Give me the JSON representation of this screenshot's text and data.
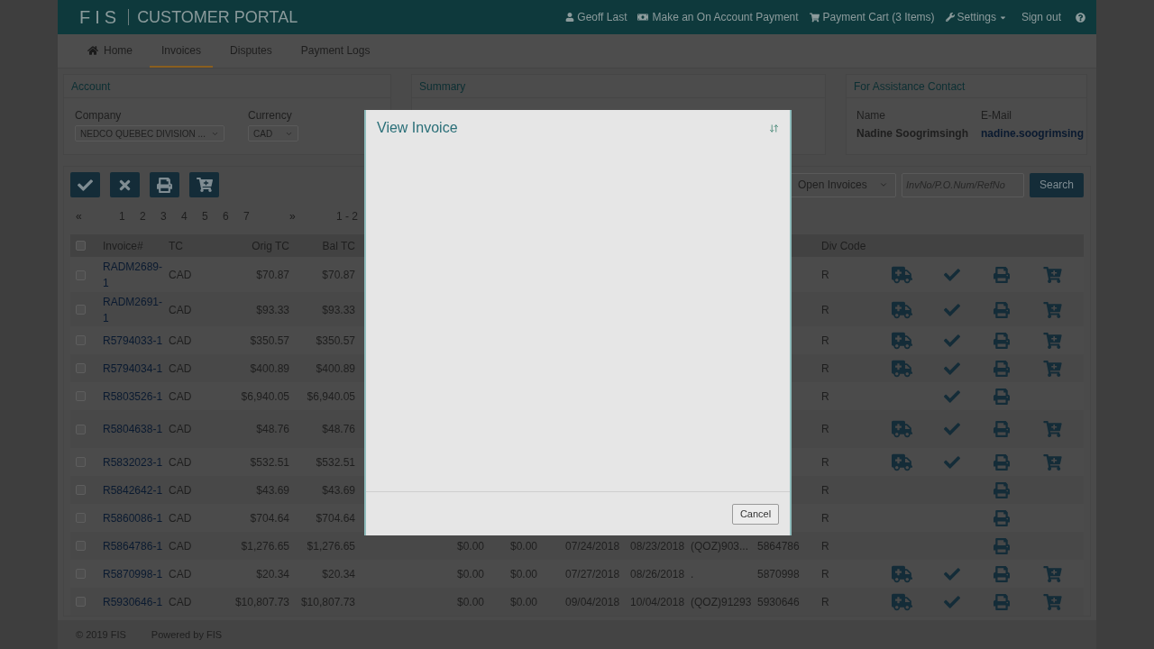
{
  "header": {
    "logo": "FIS",
    "title": "CUSTOMER PORTAL",
    "user": "Geoff Last",
    "payment_link": "Make an On Account Payment",
    "cart_link": "Payment Cart (3 Items)",
    "settings": "Settings",
    "sign_out": "Sign out"
  },
  "nav": [
    {
      "label": "Home",
      "selected": false
    },
    {
      "label": "Invoices",
      "selected": true
    },
    {
      "label": "Disputes",
      "selected": false
    },
    {
      "label": "Payment Logs",
      "selected": false
    }
  ],
  "account": {
    "title": "Account",
    "company_label": "Company",
    "company_value": "NEDCO QUEBEC DIVISION ...",
    "currency_label": "Currency",
    "currency_value": "CAD"
  },
  "summary": {
    "title": "Summary"
  },
  "contact": {
    "title": "For Assistance Contact",
    "name_label": "Name",
    "name": "Nadine Soogrimsingh",
    "email_label": "E-Mail",
    "email": "nadine.soogrimsing"
  },
  "filter": {
    "value": "Open Invoices",
    "placeholder": "InvNo/P.O.Num/RefNo",
    "button": "Search"
  },
  "pagination": {
    "first": "«",
    "pages": [
      "1",
      "2",
      "3",
      "4",
      "5",
      "6",
      "7"
    ],
    "last": "»",
    "range": "1 - 2"
  },
  "table": {
    "header_checked": false,
    "columns": [
      "Invoice#",
      "TC",
      "Orig TC",
      "Bal TC",
      "Div Code"
    ],
    "rows": [
      {
        "checked": false,
        "invoice": "RADM2689-1",
        "tc": "CAD",
        "orig_tc": "$70.87",
        "bal_tc": "$70.87",
        "div_code": "R",
        "truck": true,
        "check": true,
        "cart": true
      },
      {
        "checked": false,
        "invoice": "RADM2691-1",
        "tc": "CAD",
        "orig_tc": "$93.33",
        "bal_tc": "$93.33",
        "div_code": "R",
        "truck": true,
        "check": true,
        "cart": true
      },
      {
        "checked": false,
        "invoice": "R5794033-1",
        "tc": "CAD",
        "orig_tc": "$350.57",
        "bal_tc": "$350.57",
        "div_code": "R",
        "truck": true,
        "check": true,
        "cart": true
      },
      {
        "checked": false,
        "invoice": "R5794034-1",
        "tc": "CAD",
        "orig_tc": "$400.89",
        "bal_tc": "$400.89",
        "div_code": "R",
        "truck": true,
        "check": true,
        "cart": true
      },
      {
        "checked": false,
        "invoice": "R5803526-1",
        "tc": "CAD",
        "orig_tc": "$6,940.05",
        "bal_tc": "$6,940.05",
        "div_code": "R",
        "truck": false,
        "check": true,
        "cart": false
      },
      {
        "checked": false,
        "invoice": "R5804638-1",
        "tc": "CAD",
        "orig_tc": "$48.76",
        "bal_tc": "$48.76",
        "div_code": "R",
        "truck": true,
        "check": true,
        "cart": true
      },
      {
        "checked": false,
        "invoice": "R5832023-1",
        "tc": "CAD",
        "orig_tc": "$532.51",
        "bal_tc": "$532.51",
        "div_code": "R",
        "truck": true,
        "check": true,
        "cart": true
      },
      {
        "checked": false,
        "invoice": "R5842642-1",
        "tc": "CAD",
        "orig_tc": "$43.69",
        "bal_tc": "$43.69",
        "div_code": "R",
        "truck": false,
        "check": false,
        "cart": false
      },
      {
        "checked": false,
        "invoice": "R5860086-1",
        "tc": "CAD",
        "orig_tc": "$704.64",
        "bal_tc": "$704.64",
        "div_code": "R",
        "truck": false,
        "check": false,
        "cart": false
      },
      {
        "checked": false,
        "invoice": "R5864786-1",
        "tc": "CAD",
        "orig_tc": "$1,276.65",
        "bal_tc": "$1,276.65",
        "column_7": "$0.00",
        "column_8": "$0.00",
        "column_9": "07/24/2018",
        "column_10": "08/23/2018",
        "column_11": "(QOZ)903...",
        "column_12": "5864786",
        "div_code": "R",
        "truck": false,
        "check": false,
        "cart": false
      },
      {
        "checked": false,
        "invoice": "R5870998-1",
        "tc": "CAD",
        "orig_tc": "$20.34",
        "bal_tc": "$20.34",
        "column_7": "$0.00",
        "column_8": "$0.00",
        "column_9": "07/27/2018",
        "column_10": "08/26/2018",
        "column_11": ".",
        "column_12": "5870998",
        "div_code": "R",
        "truck": true,
        "check": true,
        "cart": true
      },
      {
        "checked": false,
        "invoice": "R5930646-1",
        "tc": "CAD",
        "orig_tc": "$10,807.73",
        "bal_tc": "$10,807.73",
        "column_7": "$0.00",
        "column_8": "$0.00",
        "column_9": "09/04/2018",
        "column_10": "10/04/2018",
        "column_11": "(QOZ)91293",
        "column_12": "5930646",
        "div_code": "R",
        "truck": true,
        "check": true,
        "cart": true
      }
    ]
  },
  "modal": {
    "title": "View Invoice",
    "cancel": "Cancel"
  },
  "footer": {
    "copyright": "© 2019 FIS",
    "powered": "Powered by FIS"
  }
}
